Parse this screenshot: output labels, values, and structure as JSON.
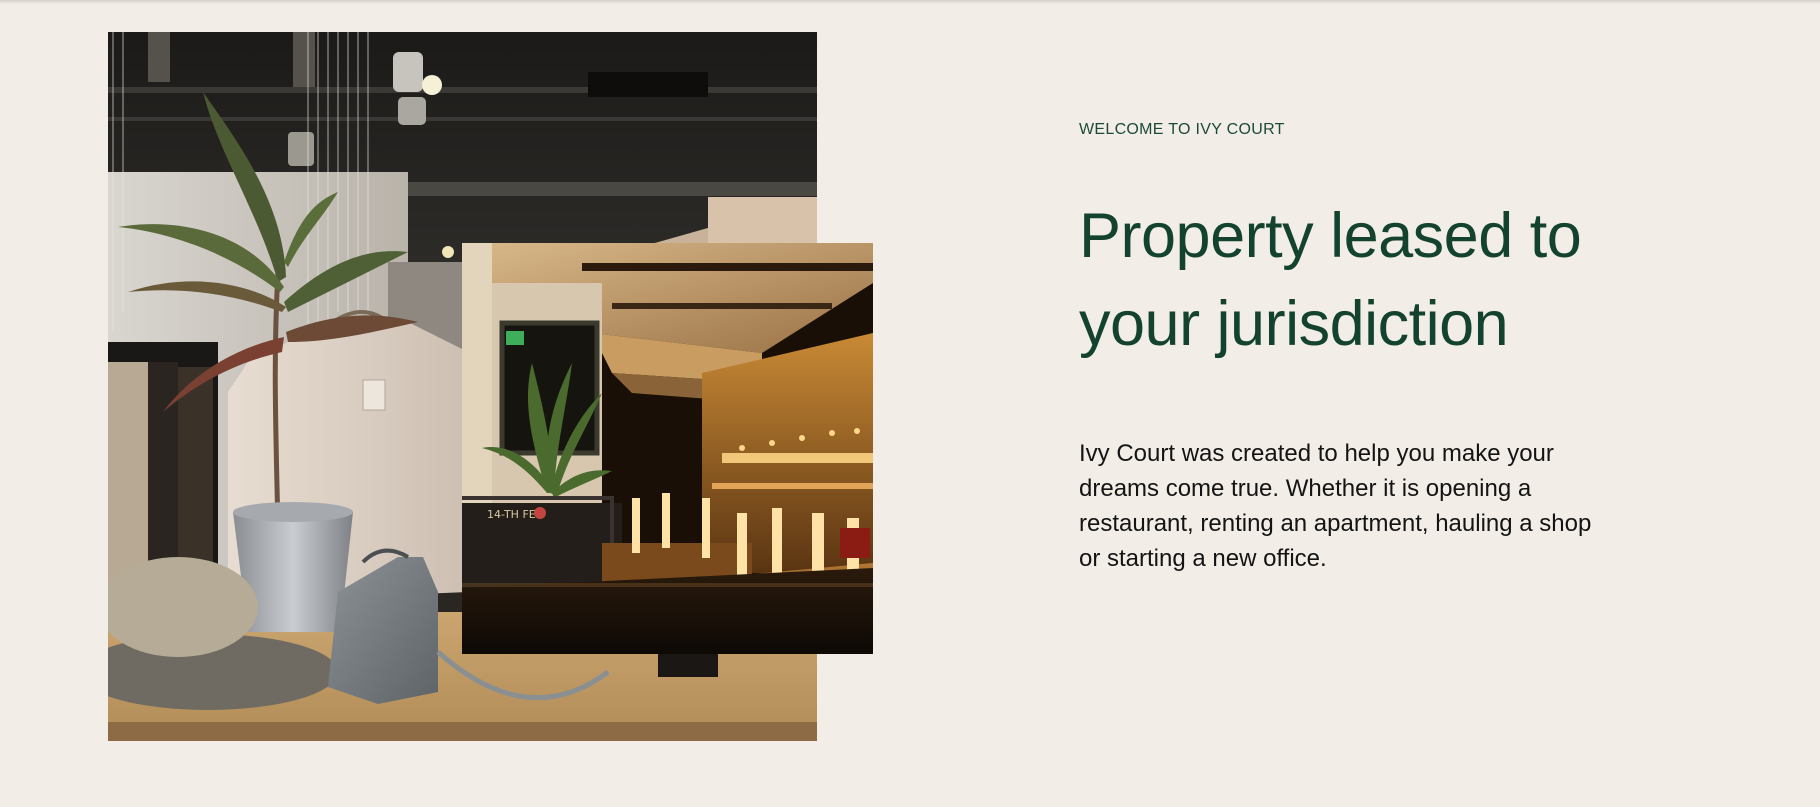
{
  "section": {
    "eyebrow": "WELCOME TO IVY COURT",
    "headline_line1": "Property leased to",
    "headline_line2": "your jurisdiction",
    "body": "Ivy Court was created to help you make your dreams come true. Whether it is opening a restaurant, renting an apartment, hauling a shop or starting a new office."
  },
  "images": {
    "boutique_alt": "Clothing boutique interior with a potted plant, hanging garments, a hat and a grey handbag",
    "bar_alt": "Dimly lit restaurant bar with warm lighting and a potted palm"
  },
  "sign_text": {
    "chalkboard": "14-TH FEB"
  },
  "colors": {
    "background": "#f2ede6",
    "headline": "#13432f",
    "eyebrow": "#1c4a3a",
    "body": "#141414"
  }
}
